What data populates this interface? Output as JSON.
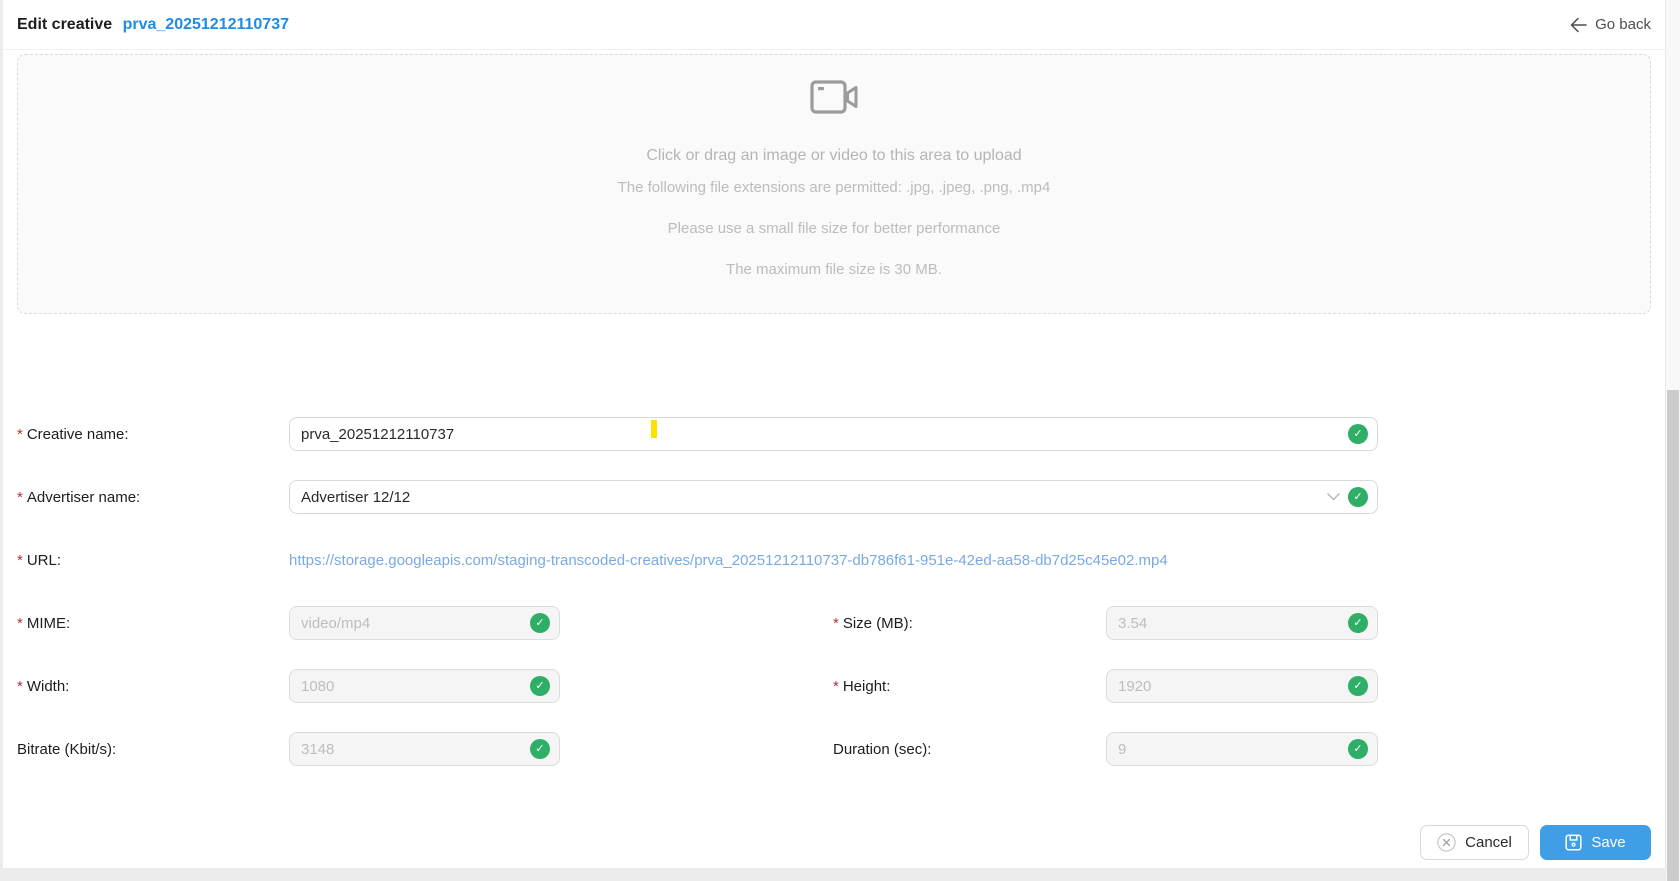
{
  "header": {
    "title_prefix": "Edit creative",
    "title_name": "prva_20251212110737",
    "back_label": "Go back"
  },
  "uploader": {
    "line1": "Click or drag an image or video to this area to upload",
    "line2": "The following file extensions are permitted: .jpg, .jpeg, .png, .mp4",
    "line3": "Please use a small file size for better performance",
    "line4": "The maximum file size is 30 MB."
  },
  "form": {
    "required_mark": "*",
    "creative_name": {
      "label": "Creative name:",
      "value": "prva_20251212110737"
    },
    "advertiser_name": {
      "label": "Advertiser name:",
      "value": "Advertiser 12/12"
    },
    "url": {
      "label": "URL:",
      "value": "https://storage.googleapis.com/staging-transcoded-creatives/prva_20251212110737-db786f61-951e-42ed-aa58-db7d25c45e02.mp4"
    },
    "mime": {
      "label": "MIME:",
      "value": "video/mp4"
    },
    "size": {
      "label": "Size (MB):",
      "value": "3.54"
    },
    "width": {
      "label": "Width:",
      "value": "1080"
    },
    "height": {
      "label": "Height:",
      "value": "1920"
    },
    "bitrate": {
      "label": "Bitrate (Kbit/s):",
      "value": "3148"
    },
    "duration": {
      "label": "Duration (sec):",
      "value": "9"
    }
  },
  "footer": {
    "cancel_label": "Cancel",
    "save_label": "Save"
  },
  "icons": {
    "check": "✓"
  },
  "colors": {
    "accent_blue": "#1d8ce8",
    "link_blue": "#78aae1",
    "success_green": "#2fae68",
    "save_blue": "#3f9ee6",
    "caret_yellow": "#ffe000"
  }
}
